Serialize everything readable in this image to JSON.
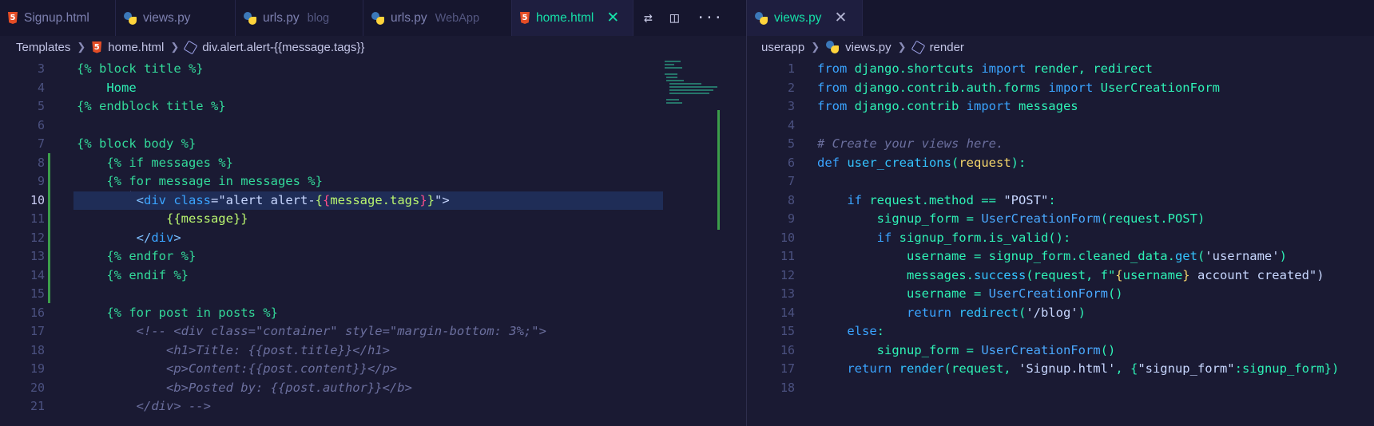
{
  "left": {
    "tabs": [
      {
        "label": "Signup.html",
        "icon": "html-icon"
      },
      {
        "label": "views.py",
        "icon": "python-icon"
      },
      {
        "label": "urls.py",
        "desc": "blog",
        "icon": "python-icon"
      },
      {
        "label": "urls.py",
        "desc": "WebApp",
        "icon": "python-icon"
      },
      {
        "label": "home.html",
        "icon": "html-icon",
        "active": true,
        "close": "✕"
      }
    ],
    "actions": [
      "source-control-icon",
      "split-editor-icon",
      "more-icon"
    ],
    "breadcrumbs": [
      "Templates",
      "home.html",
      "div.alert.alert-{{message.tags}}"
    ],
    "current_line": 10,
    "lines": [
      {
        "n": "3",
        "tokens": [
          [
            "{% block title %}",
            "tag"
          ]
        ]
      },
      {
        "n": "4",
        "tokens": [
          [
            "    Home",
            "plain"
          ]
        ]
      },
      {
        "n": "5",
        "tokens": [
          [
            "{% endblock title %}",
            "tag"
          ]
        ]
      },
      {
        "n": "6",
        "tokens": []
      },
      {
        "n": "7",
        "tokens": [
          [
            "{% block body %}",
            "tag"
          ]
        ]
      },
      {
        "n": "8",
        "tokens": [
          [
            "    {% if messages %}",
            "tag"
          ]
        ]
      },
      {
        "n": "9",
        "tokens": [
          [
            "    {% for message in messages %}",
            "tag"
          ]
        ]
      },
      {
        "n": "10",
        "tokens": [
          [
            "        <",
            "punct"
          ],
          [
            "div ",
            "kw"
          ],
          [
            "class",
            "kw"
          ],
          [
            "=\"alert alert-",
            "str"
          ],
          [
            "{",
            "var"
          ],
          [
            "{",
            "brace"
          ],
          [
            "message.tags",
            "var"
          ],
          [
            "}",
            "brace"
          ],
          [
            "}",
            "var"
          ],
          [
            "\">",
            "str"
          ]
        ]
      },
      {
        "n": "11",
        "tokens": [
          [
            "            {{message}}",
            "var"
          ]
        ]
      },
      {
        "n": "12",
        "tokens": [
          [
            "        </",
            "punct"
          ],
          [
            "div",
            "kw"
          ],
          [
            ">",
            "punct"
          ]
        ]
      },
      {
        "n": "13",
        "tokens": [
          [
            "    {% endfor %}",
            "tag"
          ]
        ]
      },
      {
        "n": "14",
        "tokens": [
          [
            "    {% endif %}",
            "tag"
          ]
        ]
      },
      {
        "n": "15",
        "tokens": []
      },
      {
        "n": "16",
        "tokens": [
          [
            "    {% for post in posts %}",
            "tag"
          ]
        ]
      },
      {
        "n": "17",
        "tokens": [
          [
            "        <!-- <div class=\"container\" style=\"margin-bottom: 3%;\">",
            "comment"
          ]
        ]
      },
      {
        "n": "18",
        "tokens": [
          [
            "            <h1>Title: {{post.title}}</h1>",
            "comment"
          ]
        ]
      },
      {
        "n": "19",
        "tokens": [
          [
            "            <p>Content:{{post.content}}</p>",
            "comment"
          ]
        ]
      },
      {
        "n": "20",
        "tokens": [
          [
            "            <b>Posted by: {{post.author}}</b>",
            "comment"
          ]
        ]
      },
      {
        "n": "21",
        "tokens": [
          [
            "        </div> -->",
            "comment"
          ]
        ]
      }
    ]
  },
  "right": {
    "tabs": [
      {
        "label": "views.py",
        "icon": "python-icon",
        "active": true,
        "close": "✕"
      }
    ],
    "breadcrumbs": [
      "userapp",
      "views.py",
      "render"
    ],
    "lines": [
      {
        "n": "1",
        "tokens": [
          [
            "from ",
            "kw"
          ],
          [
            "django.shortcuts ",
            "plain"
          ],
          [
            "import ",
            "kw"
          ],
          [
            "render, redirect",
            "plain"
          ]
        ]
      },
      {
        "n": "2",
        "tokens": [
          [
            "from ",
            "kw"
          ],
          [
            "django.contrib.auth.forms ",
            "plain"
          ],
          [
            "import ",
            "kw"
          ],
          [
            "UserCreationForm",
            "plain"
          ]
        ]
      },
      {
        "n": "3",
        "tokens": [
          [
            "from ",
            "kw"
          ],
          [
            "django.contrib ",
            "plain"
          ],
          [
            "import ",
            "kw"
          ],
          [
            "messages",
            "plain"
          ]
        ]
      },
      {
        "n": "4",
        "tokens": []
      },
      {
        "n": "5",
        "tokens": [
          [
            "# Create your views here.",
            "comment"
          ]
        ]
      },
      {
        "n": "6",
        "tokens": [
          [
            "def ",
            "kw"
          ],
          [
            "user_creations",
            "fn"
          ],
          [
            "(",
            "plain"
          ],
          [
            "request",
            "param"
          ],
          [
            "):",
            "plain"
          ]
        ]
      },
      {
        "n": "7",
        "tokens": []
      },
      {
        "n": "8",
        "tokens": [
          [
            "    if ",
            "kw"
          ],
          [
            "request.method == ",
            "plain"
          ],
          [
            "\"POST\"",
            "str"
          ],
          [
            ":",
            "plain"
          ]
        ]
      },
      {
        "n": "9",
        "tokens": [
          [
            "        signup_form = ",
            "plain"
          ],
          [
            "UserCreationForm",
            "cls"
          ],
          [
            "(request.POST)",
            "plain"
          ]
        ]
      },
      {
        "n": "10",
        "tokens": [
          [
            "        if ",
            "kw"
          ],
          [
            "signup_form.is_valid():",
            "plain"
          ]
        ]
      },
      {
        "n": "11",
        "tokens": [
          [
            "            username = signup_form.cleaned_data.",
            "plain"
          ],
          [
            "get",
            "fn"
          ],
          [
            "(",
            "plain"
          ],
          [
            "'username'",
            "str"
          ],
          [
            ")",
            "plain"
          ]
        ]
      },
      {
        "n": "12",
        "tokens": [
          [
            "            messages.",
            "plain"
          ],
          [
            "success",
            "fn"
          ],
          [
            "(request, f\"",
            "plain"
          ],
          [
            "{",
            "gold"
          ],
          [
            "username",
            "plain"
          ],
          [
            "}",
            "gold"
          ],
          [
            " account created\")",
            "str"
          ]
        ]
      },
      {
        "n": "13",
        "tokens": [
          [
            "            username = ",
            "plain"
          ],
          [
            "UserCreationForm",
            "cls"
          ],
          [
            "()",
            "plain"
          ]
        ]
      },
      {
        "n": "14",
        "tokens": [
          [
            "            return ",
            "kw"
          ],
          [
            "redirect",
            "fn"
          ],
          [
            "(",
            "plain"
          ],
          [
            "'/blog'",
            "str"
          ],
          [
            ")",
            "plain"
          ]
        ]
      },
      {
        "n": "15",
        "tokens": [
          [
            "    else",
            "kw"
          ],
          [
            ":",
            "plain"
          ]
        ]
      },
      {
        "n": "16",
        "tokens": [
          [
            "        signup_form = ",
            "plain"
          ],
          [
            "UserCreationForm",
            "cls"
          ],
          [
            "()",
            "plain"
          ]
        ]
      },
      {
        "n": "17",
        "tokens": [
          [
            "    return ",
            "kw"
          ],
          [
            "render",
            "fn"
          ],
          [
            "(request, ",
            "plain"
          ],
          [
            "'Signup.html'",
            "str"
          ],
          [
            ", {",
            "plain"
          ],
          [
            "\"signup_form\"",
            "str"
          ],
          [
            ":signup_form})",
            "plain"
          ]
        ]
      },
      {
        "n": "18",
        "tokens": []
      }
    ]
  },
  "colors": {
    "background": "#1a1a33",
    "accent": "#15e0a8",
    "current_line": "#1f2d57",
    "git_added": "#3c9e4a"
  }
}
